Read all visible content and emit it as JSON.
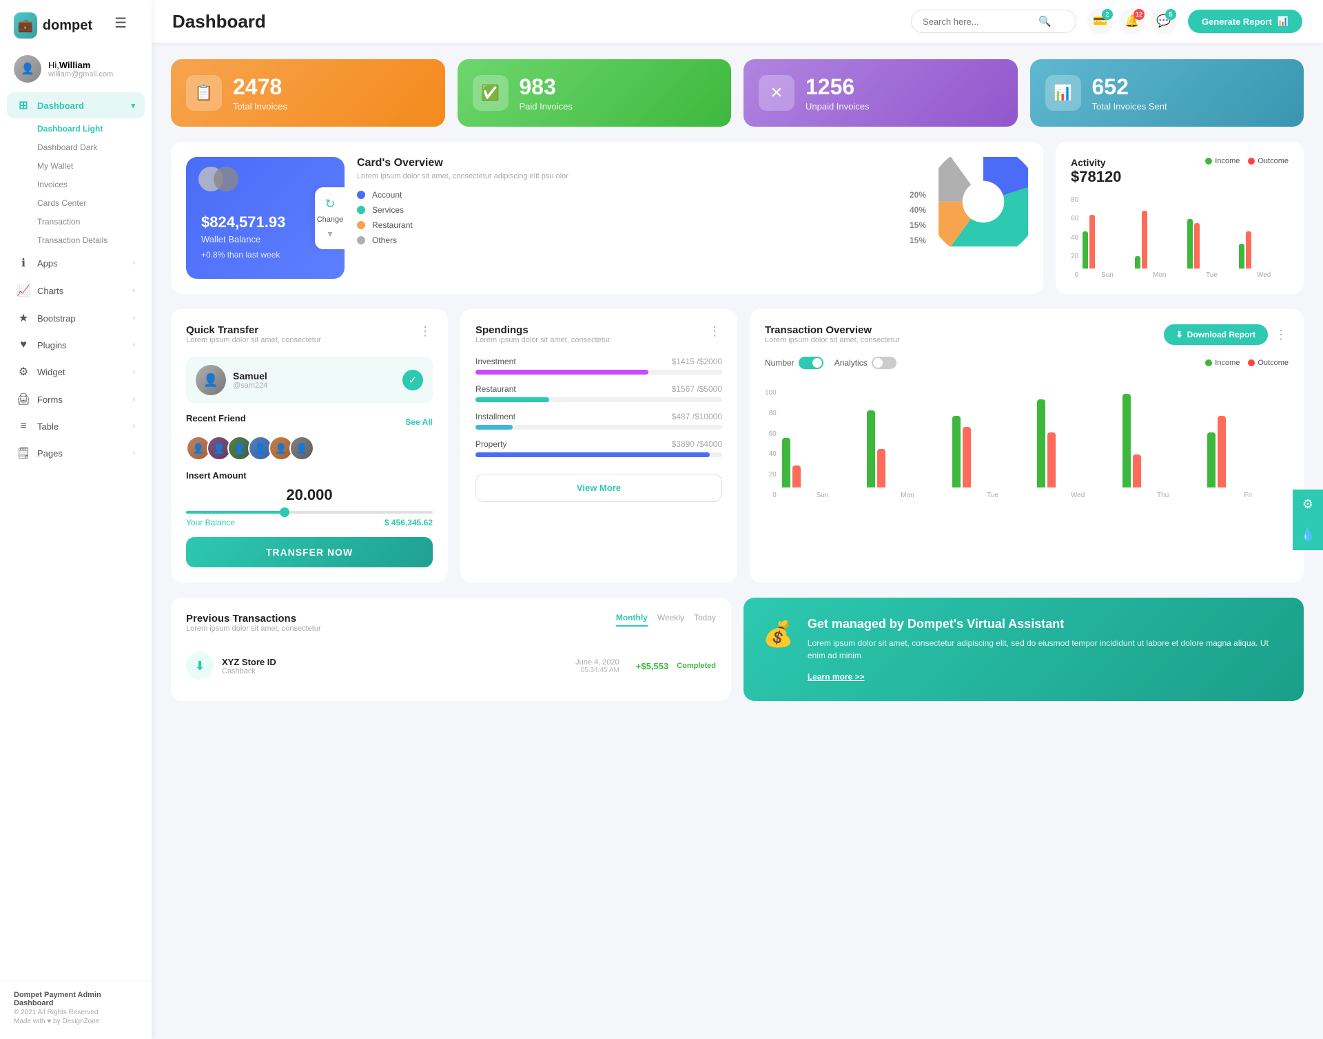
{
  "app": {
    "logo": "dompet",
    "logo_icon": "💼"
  },
  "header": {
    "title": "Dashboard",
    "search_placeholder": "Search here...",
    "generate_btn": "Generate Report",
    "badge_wallet": "2",
    "badge_bell": "12",
    "badge_chat": "5"
  },
  "sidebar": {
    "user": {
      "greeting": "Hi,",
      "name": "William",
      "email": "william@gmail.com"
    },
    "nav": [
      {
        "id": "dashboard",
        "label": "Dashboard",
        "icon": "⊞",
        "active": true,
        "has_submenu": true
      },
      {
        "id": "apps",
        "label": "Apps",
        "icon": "ℹ",
        "active": false,
        "has_submenu": true
      },
      {
        "id": "charts",
        "label": "Charts",
        "icon": "📈",
        "active": false,
        "has_submenu": true
      },
      {
        "id": "bootstrap",
        "label": "Bootstrap",
        "icon": "★",
        "active": false,
        "has_submenu": true
      },
      {
        "id": "plugins",
        "label": "Plugins",
        "icon": "♥",
        "active": false,
        "has_submenu": true
      },
      {
        "id": "widget",
        "label": "Widget",
        "icon": "⚙",
        "active": false,
        "has_submenu": true
      },
      {
        "id": "forms",
        "label": "Forms",
        "icon": "🖨",
        "active": false,
        "has_submenu": true
      },
      {
        "id": "table",
        "label": "Table",
        "icon": "≡",
        "active": false,
        "has_submenu": true
      },
      {
        "id": "pages",
        "label": "Pages",
        "icon": "🗒",
        "active": false,
        "has_submenu": true
      }
    ],
    "submenu": [
      {
        "label": "Dashboard Light",
        "active": true
      },
      {
        "label": "Dashboard Dark",
        "active": false
      },
      {
        "label": "My Wallet",
        "active": false
      },
      {
        "label": "Invoices",
        "active": false
      },
      {
        "label": "Cards Center",
        "active": false
      },
      {
        "label": "Transaction",
        "active": false
      },
      {
        "label": "Transaction Details",
        "active": false
      }
    ],
    "footer": {
      "title": "Dompet Payment Admin Dashboard",
      "copy": "© 2021 All Rights Reserved",
      "made": "Made with ♥ by DesignZone"
    }
  },
  "stats": [
    {
      "id": "total-invoices",
      "number": "2478",
      "label": "Total Invoices",
      "icon": "📋",
      "color": "orange"
    },
    {
      "id": "paid-invoices",
      "number": "983",
      "label": "Paid Invoices",
      "icon": "✅",
      "color": "green"
    },
    {
      "id": "unpaid-invoices",
      "number": "1256",
      "label": "Unpaid Invoices",
      "icon": "✗",
      "color": "purple"
    },
    {
      "id": "total-sent",
      "number": "652",
      "label": "Total Invoices Sent",
      "icon": "📊",
      "color": "teal"
    }
  ],
  "cards_overview": {
    "wallet_balance": "$824,571.93",
    "wallet_label": "Wallet Balance",
    "wallet_change": "+0.8% than last week",
    "change_btn": "Change",
    "title": "Card's Overview",
    "subtitle": "Lorem ipsum dolor sit amet, consectetur adipiscing elit psu olor",
    "items": [
      {
        "name": "Account",
        "pct": "20%",
        "color": "blue"
      },
      {
        "name": "Services",
        "pct": "40%",
        "color": "teal2"
      },
      {
        "name": "Restaurant",
        "pct": "15%",
        "color": "orange"
      },
      {
        "name": "Others",
        "pct": "15%",
        "color": "gray"
      }
    ]
  },
  "activity": {
    "title": "Activity",
    "amount": "$78120",
    "legend": [
      {
        "label": "Income",
        "color": "green"
      },
      {
        "label": "Outcome",
        "color": "red"
      }
    ],
    "bars": [
      {
        "day": "Sun",
        "income": 45,
        "outcome": 65
      },
      {
        "day": "Mon",
        "income": 15,
        "outcome": 70
      },
      {
        "day": "Tue",
        "income": 60,
        "outcome": 55
      },
      {
        "day": "Wed",
        "income": 30,
        "outcome": 45
      }
    ],
    "y_labels": [
      "80",
      "60",
      "40",
      "20",
      "0"
    ]
  },
  "quick_transfer": {
    "title": "Quick Transfer",
    "subtitle": "Lorem ipsum dolor sit amet, consectetur",
    "user_name": "Samuel",
    "user_handle": "@sam224",
    "recent_label": "Recent Friend",
    "see_all": "See All",
    "insert_label": "Insert Amount",
    "amount": "20.000",
    "balance_label": "Your Balance",
    "balance": "$ 456,345.62",
    "transfer_btn": "TRANSFER NOW",
    "friends": [
      "👤",
      "👤",
      "👤",
      "👤",
      "👤",
      "👤"
    ]
  },
  "spendings": {
    "title": "Spendings",
    "subtitle": "Lorem ipsum dolor sit amet, consectetur",
    "view_more": "View More",
    "items": [
      {
        "name": "Investment",
        "current": "$1415",
        "total": "$2000",
        "pct": 70,
        "color": "#c84bff"
      },
      {
        "name": "Restaurant",
        "current": "$1567",
        "total": "$5000",
        "pct": 30,
        "color": "#2dc9b0"
      },
      {
        "name": "Installment",
        "current": "$487",
        "total": "$10000",
        "pct": 15,
        "color": "#3db8d8"
      },
      {
        "name": "Property",
        "current": "$3890",
        "total": "$4000",
        "pct": 95,
        "color": "#4a6cf7"
      }
    ]
  },
  "transaction_overview": {
    "title": "Transaction Overview",
    "subtitle": "Lorem ipsum dolor sit amet, consectetur",
    "download_btn": "Download Report",
    "toggle_number": "Number",
    "toggle_analytics": "Analytics",
    "legend": [
      {
        "label": "Income",
        "color": "green"
      },
      {
        "label": "Outcome",
        "color": "red"
      }
    ],
    "bars": [
      {
        "day": "Sun",
        "income": 45,
        "outcome": 20
      },
      {
        "day": "Mon",
        "income": 70,
        "outcome": 35
      },
      {
        "day": "Tue",
        "income": 65,
        "outcome": 55
      },
      {
        "day": "Wed",
        "income": 80,
        "outcome": 50
      },
      {
        "day": "Thu",
        "income": 85,
        "outcome": 30
      },
      {
        "day": "Fri",
        "income": 50,
        "outcome": 65
      }
    ],
    "y_labels": [
      "100",
      "80",
      "60",
      "40",
      "20",
      "0"
    ]
  },
  "prev_transactions": {
    "title": "Previous Transactions",
    "subtitle": "Lorem ipsum dolor sit amet, consectetur",
    "tabs": [
      "Monthly",
      "Weekly",
      "Today"
    ],
    "active_tab": "Monthly",
    "items": [
      {
        "name": "XYZ Store ID",
        "type": "Cashback",
        "date": "June 4, 2020",
        "time": "05:34:45 AM",
        "amount": "+$5,553",
        "status": "Completed",
        "icon": "⬇"
      }
    ]
  },
  "virtual_assistant": {
    "title": "Get managed by Dompet's Virtual Assistant",
    "desc": "Lorem ipsum dolor sit amet, consectetur adipiscing elit, sed do eiusmod tempor incididunt ut labore et dolore magna aliqua. Ut enim ad minim",
    "link": "Learn more >>",
    "icon": "💰"
  }
}
